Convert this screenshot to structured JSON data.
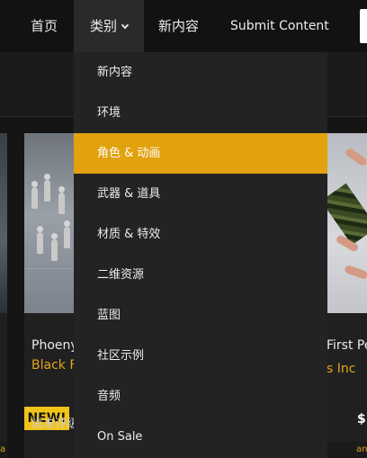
{
  "nav": {
    "home": "首页",
    "categories": "类别",
    "new_content": "新内容",
    "submit": "Submit Content"
  },
  "dropdown": {
    "items": [
      {
        "label": "新内容"
      },
      {
        "label": "环境"
      },
      {
        "label": "角色 & 动画",
        "active": true
      },
      {
        "label": "武器 & 道具"
      },
      {
        "label": "材质 & 特效"
      },
      {
        "label": "二维资源"
      },
      {
        "label": "蓝图"
      },
      {
        "label": "社区示例"
      },
      {
        "label": "音频"
      },
      {
        "label": "On Sale"
      }
    ]
  },
  "cards": {
    "c1": {
      "title": "Phoeny",
      "seller": "Black F",
      "badge": "NEW!",
      "rating": "尚未评级"
    },
    "c2": {
      "title": "First Pe",
      "seller": "s Inc",
      "price": "$",
      "strip": "an"
    },
    "c0": {
      "strip": "a"
    }
  },
  "colors": {
    "accent": "#e1a20e",
    "seller": "#e1a51a",
    "badge": "#f0c419",
    "dropdown_bg": "#232323",
    "nav_bg": "#121212"
  },
  "icons": {
    "categories_toggle": "chevron-down-icon"
  }
}
